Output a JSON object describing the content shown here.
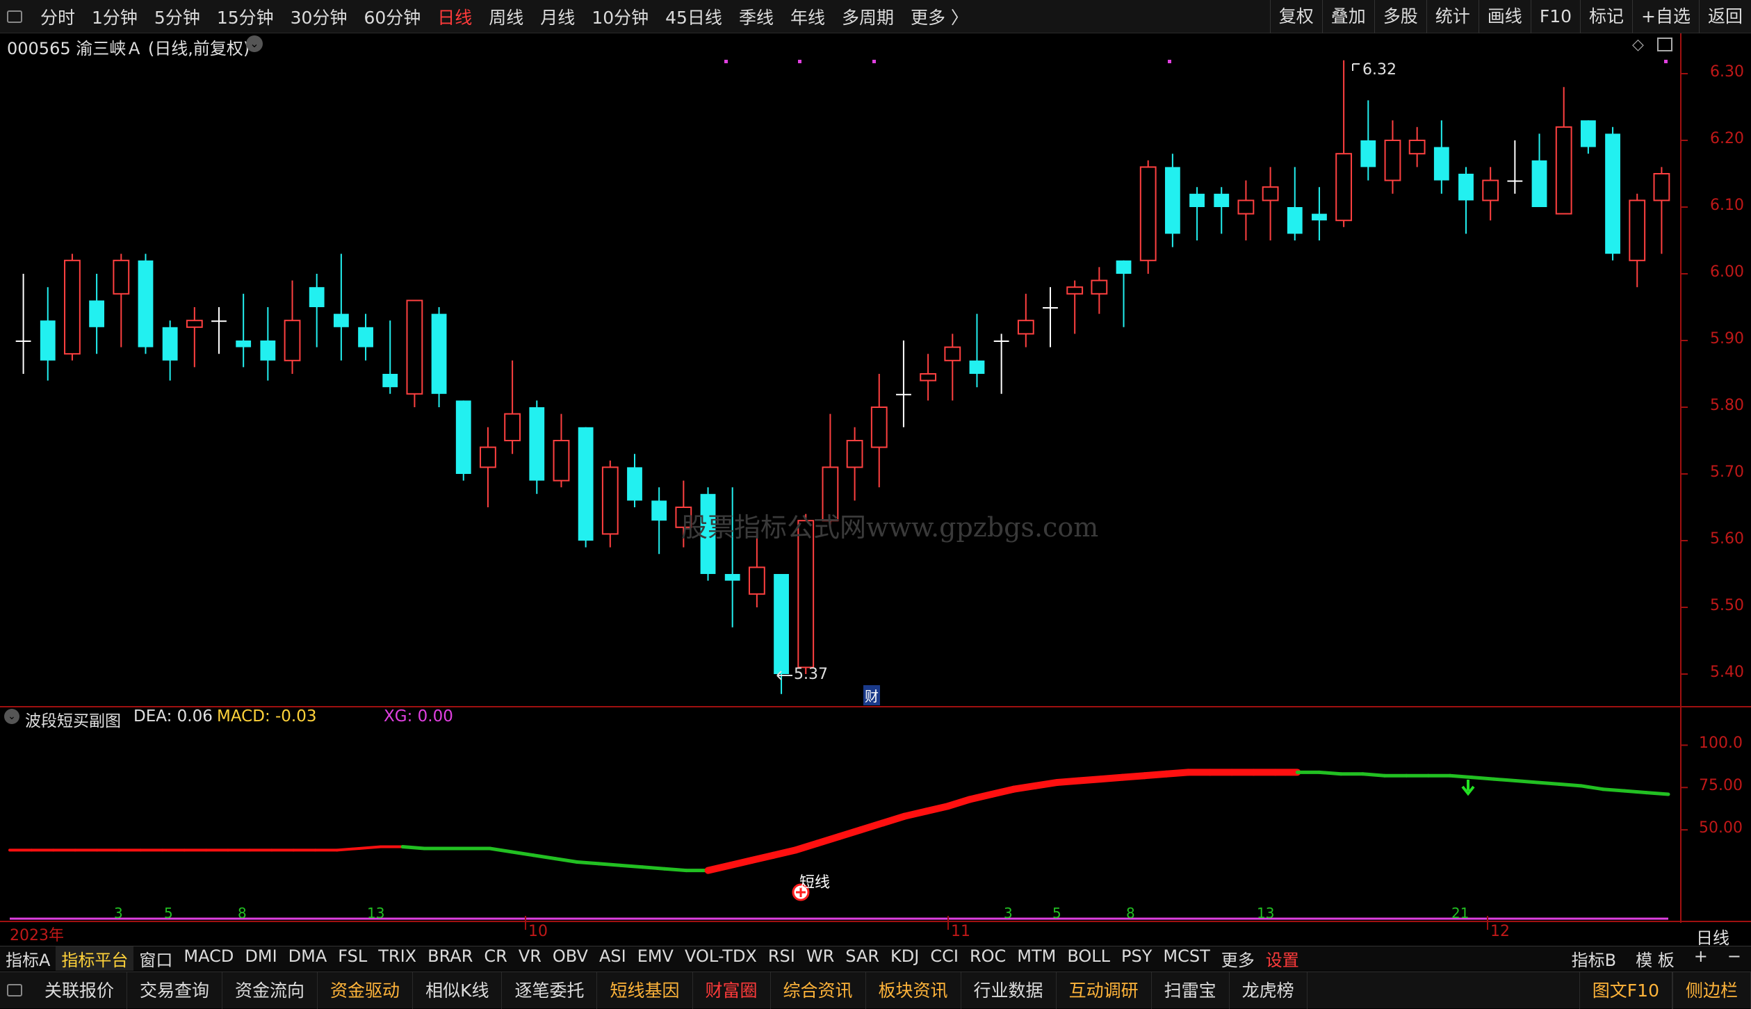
{
  "toolbar": {
    "periods": [
      "分时",
      "1分钟",
      "5分钟",
      "15分钟",
      "30分钟",
      "60分钟",
      "日线",
      "周线",
      "月线",
      "10分钟",
      "45日线",
      "季线",
      "年线",
      "多周期",
      "更多 〉"
    ],
    "active_period": "日线",
    "right_buttons": [
      "复权",
      "叠加",
      "多股",
      "统计",
      "画线",
      "F10",
      "标记",
      "+自选",
      "返回"
    ]
  },
  "stock": {
    "title": "000565 渝三峡Ａ (日线,前复权)",
    "high_label": "6.32",
    "low_label": "5.37",
    "fin_marker": "财",
    "watermark": "股票指标公式网www.gpzbgs.com",
    "price_ticks": [
      "6.30",
      "6.20",
      "6.10",
      "6.00",
      "5.90",
      "5.80",
      "5.70",
      "5.60",
      "5.50",
      "5.40"
    ]
  },
  "indicator": {
    "name": "波段短买副图",
    "dea": "DEA: 0.06",
    "macd": "MACD: -0.03",
    "xg": "XG: 0.00",
    "ticks": [
      "100.0",
      "75.00",
      "50.00"
    ],
    "signal_label": "短线",
    "bottom_numbers": [
      "3",
      "5",
      "8",
      "13",
      "3",
      "5",
      "8",
      "13",
      "21"
    ]
  },
  "dates": {
    "year": "2023年",
    "months": [
      "10",
      "11",
      "12"
    ],
    "period_label": "日线"
  },
  "indicator_tabs": {
    "left": [
      "指标A",
      "指标平台",
      "窗口",
      "MACD",
      "DMI",
      "DMA",
      "FSL",
      "TRIX",
      "BRAR",
      "CR",
      "VR",
      "OBV",
      "ASI",
      "EMV",
      "VOL-TDX",
      "RSI",
      "WR",
      "SAR",
      "KDJ",
      "CCI",
      "ROC",
      "MTM",
      "BOLL",
      "PSY",
      "MCST",
      "更多",
      "设置"
    ],
    "highlight": "指标平台",
    "red": "设置",
    "right": [
      "指标B",
      "模 板",
      "+",
      "−"
    ]
  },
  "bottom_tabs": {
    "items": [
      {
        "label": "关联报价",
        "color": "#dcdcdc"
      },
      {
        "label": "交易查询",
        "color": "#dcdcdc"
      },
      {
        "label": "资金流向",
        "color": "#dcdcdc"
      },
      {
        "label": "资金驱动",
        "color": "#ffb43a"
      },
      {
        "label": "相似K线",
        "color": "#dcdcdc"
      },
      {
        "label": "逐笔委托",
        "color": "#dcdcdc"
      },
      {
        "label": "短线基因",
        "color": "#ffb43a"
      },
      {
        "label": "财富圈",
        "color": "#ff3b3b"
      },
      {
        "label": "综合资讯",
        "color": "#ffb43a"
      },
      {
        "label": "板块资讯",
        "color": "#ffb43a"
      },
      {
        "label": "行业数据",
        "color": "#dcdcdc"
      },
      {
        "label": "互动调研",
        "color": "#ffb43a"
      },
      {
        "label": "扫雷宝",
        "color": "#dcdcdc"
      },
      {
        "label": "龙虎榜",
        "color": "#dcdcdc"
      }
    ],
    "right": [
      "图文F10",
      "侧边栏"
    ]
  },
  "colors": {
    "up": "#ff4040",
    "down": "#22f0f0",
    "indicator_up": "#ff1010",
    "indicator_down": "#22c022",
    "axis": "#a01010"
  },
  "chart_data": {
    "type": "candlestick",
    "ylim": [
      5.35,
      6.35
    ],
    "candles": [
      {
        "o": 5.9,
        "c": 5.9,
        "h": 6.0,
        "l": 5.85
      },
      {
        "o": 5.93,
        "c": 5.87,
        "h": 5.98,
        "l": 5.84
      },
      {
        "o": 5.88,
        "c": 6.02,
        "h": 6.03,
        "l": 5.87
      },
      {
        "o": 5.96,
        "c": 5.92,
        "h": 6.0,
        "l": 5.88
      },
      {
        "o": 5.97,
        "c": 6.02,
        "h": 6.03,
        "l": 5.89
      },
      {
        "o": 6.02,
        "c": 5.89,
        "h": 6.03,
        "l": 5.88
      },
      {
        "o": 5.92,
        "c": 5.87,
        "h": 5.93,
        "l": 5.84
      },
      {
        "o": 5.92,
        "c": 5.93,
        "h": 5.95,
        "l": 5.86
      },
      {
        "o": 5.93,
        "c": 5.93,
        "h": 5.95,
        "l": 5.88
      },
      {
        "o": 5.9,
        "c": 5.89,
        "h": 5.97,
        "l": 5.86
      },
      {
        "o": 5.9,
        "c": 5.87,
        "h": 5.95,
        "l": 5.84
      },
      {
        "o": 5.87,
        "c": 5.93,
        "h": 5.99,
        "l": 5.85
      },
      {
        "o": 5.98,
        "c": 5.95,
        "h": 6.0,
        "l": 5.89
      },
      {
        "o": 5.94,
        "c": 5.92,
        "h": 6.03,
        "l": 5.87
      },
      {
        "o": 5.92,
        "c": 5.89,
        "h": 5.94,
        "l": 5.87
      },
      {
        "o": 5.85,
        "c": 5.83,
        "h": 5.93,
        "l": 5.82
      },
      {
        "o": 5.82,
        "c": 5.96,
        "h": 5.96,
        "l": 5.8
      },
      {
        "o": 5.94,
        "c": 5.82,
        "h": 5.95,
        "l": 5.8
      },
      {
        "o": 5.81,
        "c": 5.7,
        "h": 5.81,
        "l": 5.69
      },
      {
        "o": 5.71,
        "c": 5.74,
        "h": 5.77,
        "l": 5.65
      },
      {
        "o": 5.75,
        "c": 5.79,
        "h": 5.87,
        "l": 5.73
      },
      {
        "o": 5.8,
        "c": 5.69,
        "h": 5.81,
        "l": 5.67
      },
      {
        "o": 5.69,
        "c": 5.75,
        "h": 5.79,
        "l": 5.68
      },
      {
        "o": 5.77,
        "c": 5.6,
        "h": 5.77,
        "l": 5.59
      },
      {
        "o": 5.61,
        "c": 5.71,
        "h": 5.72,
        "l": 5.59
      },
      {
        "o": 5.71,
        "c": 5.66,
        "h": 5.73,
        "l": 5.65
      },
      {
        "o": 5.66,
        "c": 5.63,
        "h": 5.68,
        "l": 5.58
      },
      {
        "o": 5.62,
        "c": 5.65,
        "h": 5.69,
        "l": 5.59
      },
      {
        "o": 5.67,
        "c": 5.55,
        "h": 5.68,
        "l": 5.54
      },
      {
        "o": 5.55,
        "c": 5.54,
        "h": 5.68,
        "l": 5.47
      },
      {
        "o": 5.52,
        "c": 5.56,
        "h": 5.62,
        "l": 5.5
      },
      {
        "o": 5.55,
        "c": 5.4,
        "h": 5.55,
        "l": 5.37
      },
      {
        "o": 5.41,
        "c": 5.63,
        "h": 5.64,
        "l": 5.4
      },
      {
        "o": 5.63,
        "c": 5.71,
        "h": 5.79,
        "l": 5.62
      },
      {
        "o": 5.71,
        "c": 5.75,
        "h": 5.77,
        "l": 5.66
      },
      {
        "o": 5.74,
        "c": 5.8,
        "h": 5.85,
        "l": 5.68
      },
      {
        "o": 5.82,
        "c": 5.82,
        "h": 5.9,
        "l": 5.77
      },
      {
        "o": 5.84,
        "c": 5.85,
        "h": 5.88,
        "l": 5.81
      },
      {
        "o": 5.87,
        "c": 5.89,
        "h": 5.91,
        "l": 5.81
      },
      {
        "o": 5.87,
        "c": 5.85,
        "h": 5.94,
        "l": 5.83
      },
      {
        "o": 5.9,
        "c": 5.9,
        "h": 5.91,
        "l": 5.82
      },
      {
        "o": 5.91,
        "c": 5.93,
        "h": 5.97,
        "l": 5.89
      },
      {
        "o": 5.95,
        "c": 5.95,
        "h": 5.98,
        "l": 5.89
      },
      {
        "o": 5.97,
        "c": 5.98,
        "h": 5.99,
        "l": 5.91
      },
      {
        "o": 5.97,
        "c": 5.99,
        "h": 6.01,
        "l": 5.94
      },
      {
        "o": 6.02,
        "c": 6.0,
        "h": 6.02,
        "l": 5.92
      },
      {
        "o": 6.02,
        "c": 6.16,
        "h": 6.17,
        "l": 6.0
      },
      {
        "o": 6.16,
        "c": 6.06,
        "h": 6.18,
        "l": 6.04
      },
      {
        "o": 6.12,
        "c": 6.1,
        "h": 6.13,
        "l": 6.05
      },
      {
        "o": 6.12,
        "c": 6.1,
        "h": 6.13,
        "l": 6.06
      },
      {
        "o": 6.09,
        "c": 6.11,
        "h": 6.14,
        "l": 6.05
      },
      {
        "o": 6.11,
        "c": 6.13,
        "h": 6.16,
        "l": 6.05
      },
      {
        "o": 6.1,
        "c": 6.06,
        "h": 6.16,
        "l": 6.05
      },
      {
        "o": 6.09,
        "c": 6.08,
        "h": 6.13,
        "l": 6.05
      },
      {
        "o": 6.08,
        "c": 6.18,
        "h": 6.32,
        "l": 6.07
      },
      {
        "o": 6.2,
        "c": 6.16,
        "h": 6.26,
        "l": 6.14
      },
      {
        "o": 6.14,
        "c": 6.2,
        "h": 6.23,
        "l": 6.12
      },
      {
        "o": 6.18,
        "c": 6.2,
        "h": 6.22,
        "l": 6.16
      },
      {
        "o": 6.19,
        "c": 6.14,
        "h": 6.23,
        "l": 6.12
      },
      {
        "o": 6.15,
        "c": 6.11,
        "h": 6.16,
        "l": 6.06
      },
      {
        "o": 6.11,
        "c": 6.14,
        "h": 6.16,
        "l": 6.08
      },
      {
        "o": 6.14,
        "c": 6.14,
        "h": 6.2,
        "l": 6.12
      },
      {
        "o": 6.17,
        "c": 6.1,
        "h": 6.21,
        "l": 6.1
      },
      {
        "o": 6.09,
        "c": 6.22,
        "h": 6.28,
        "l": 6.09
      },
      {
        "o": 6.23,
        "c": 6.19,
        "h": 6.23,
        "l": 6.18
      },
      {
        "o": 6.21,
        "c": 6.03,
        "h": 6.22,
        "l": 6.02
      },
      {
        "o": 6.02,
        "c": 6.11,
        "h": 6.12,
        "l": 5.98
      },
      {
        "o": 6.11,
        "c": 6.15,
        "h": 6.16,
        "l": 6.03
      }
    ],
    "indicator_ylim": [
      0,
      110
    ],
    "indicator_line": [
      38,
      38,
      38,
      38,
      38,
      38,
      38,
      38,
      38,
      38,
      38,
      38,
      38,
      38,
      38,
      38,
      39,
      40,
      40,
      39,
      39,
      39,
      39,
      37,
      35,
      33,
      31,
      30,
      29,
      28,
      27,
      26,
      26,
      29,
      32,
      35,
      38,
      42,
      46,
      50,
      54,
      58,
      61,
      64,
      68,
      71,
      74,
      76,
      78,
      79,
      80,
      81,
      82,
      83,
      84,
      84,
      84,
      84,
      84,
      84,
      84,
      83,
      83,
      82,
      82,
      82,
      82,
      81,
      80,
      79,
      78,
      77,
      76,
      74,
      73,
      72,
      71
    ],
    "indicator_colors": "rrrrrrrrrrrrrrrrrrggggggggggggggrrrrrrrrrrrrrrrrrrrrrrrrrrrggggggggggggggggggggggg"
  }
}
